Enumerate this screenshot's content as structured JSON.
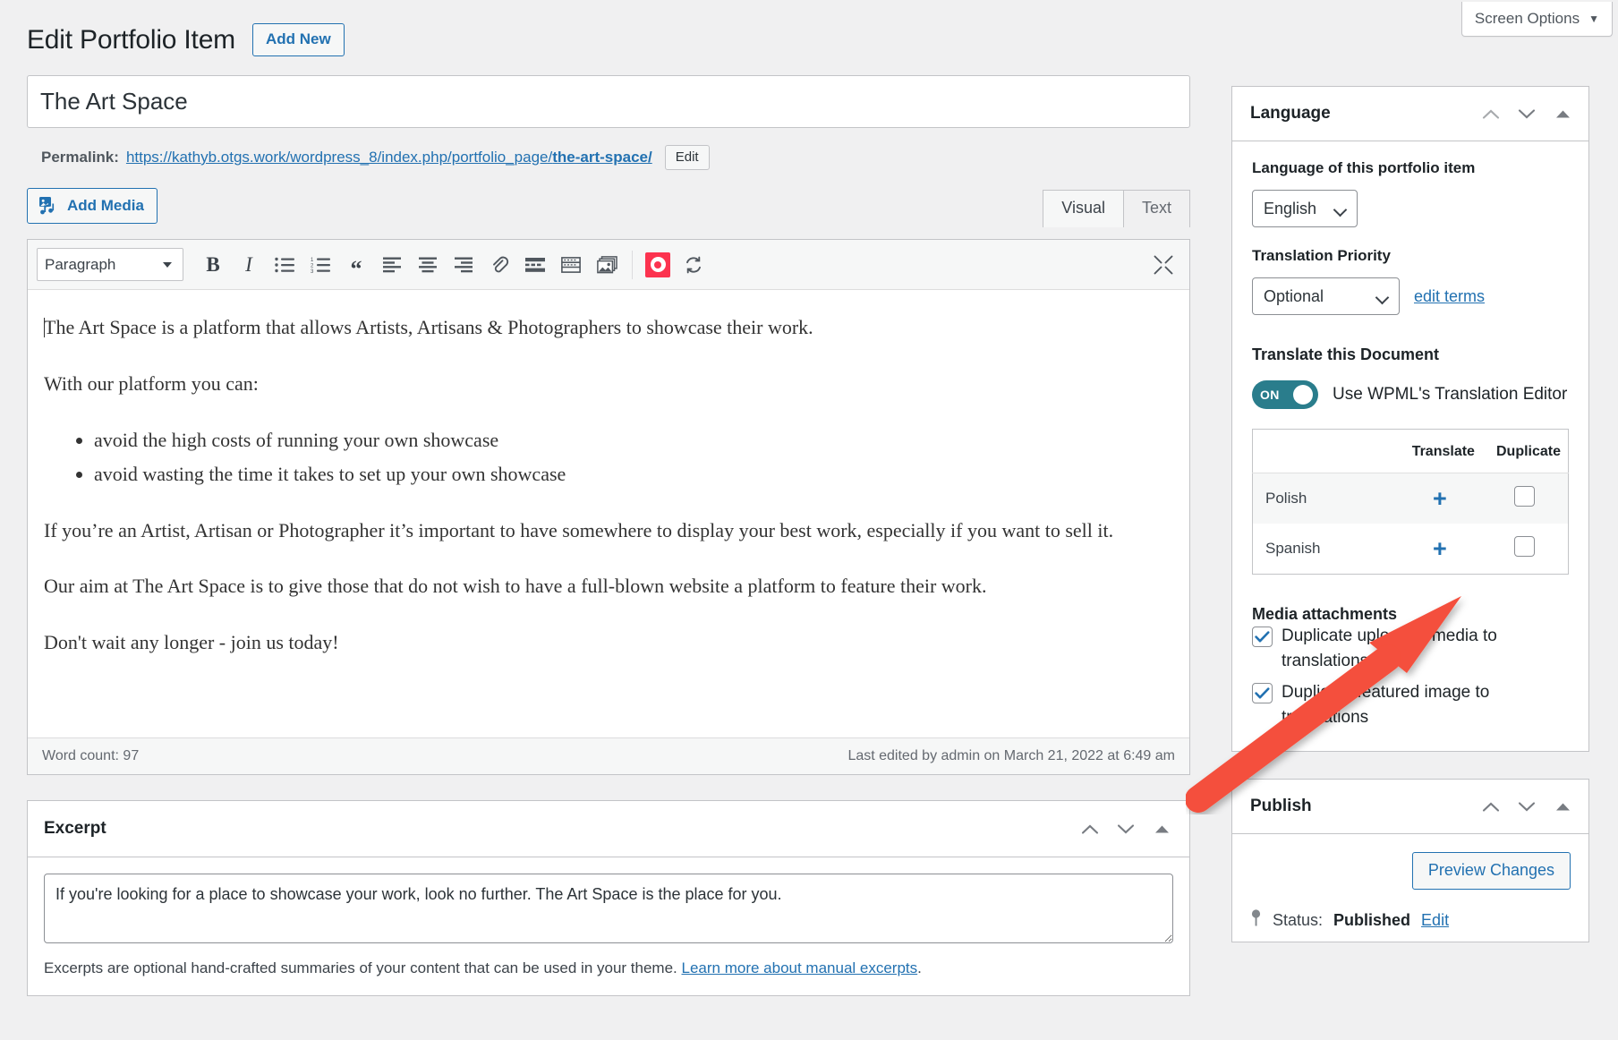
{
  "screen_options": {
    "label": "Screen Options",
    "caret": "▼"
  },
  "header": {
    "title": "Edit Portfolio Item",
    "add_new_label": "Add New"
  },
  "post": {
    "title_value": "The Art Space",
    "permalink_label": "Permalink:",
    "permalink_base": "https://kathyb.otgs.work/wordpress_8/index.php/portfolio_page/",
    "permalink_slug": "the-art-space/",
    "permalink_edit_label": "Edit"
  },
  "editor": {
    "add_media_label": "Add Media",
    "tabs": [
      {
        "label": "Visual",
        "active": true
      },
      {
        "label": "Text",
        "active": false
      }
    ],
    "toolbar": {
      "format_value": "Paragraph",
      "format_options": [
        "Paragraph"
      ],
      "buttons": [
        "bold-icon",
        "italic-icon",
        "bulleted-list-icon",
        "numbered-list-icon",
        "blockquote-icon",
        "align-left-icon",
        "align-center-icon",
        "align-right-icon",
        "link-icon",
        "read-more-icon",
        "toolbar-toggle-icon",
        "gallery-icon",
        "wpml-icon",
        "refresh-icon",
        "fullscreen-icon"
      ]
    },
    "content": {
      "p1": "The Art Space is a platform that allows Artists, Artisans & Photographers to showcase their work.",
      "p2": "With our platform you can:",
      "bullets": [
        "avoid the high costs of running your own showcase",
        "avoid wasting the time it takes to set up your own showcase"
      ],
      "p3": "If you’re an Artist, Artisan or Photographer it’s important to have somewhere to display your best work, especially if you want to sell it.",
      "p4": "Our aim at The Art Space is to give those that do not wish to have a full-blown website a platform to feature their work.",
      "p5": "Don't wait any longer - join us today!"
    },
    "status": {
      "word_count": "Word count: 97",
      "last_edited": "Last edited by admin on March 21, 2022 at 6:49 am"
    }
  },
  "excerpt": {
    "title": "Excerpt",
    "value": "If you're looking for a place to showcase your work, look no further. The Art Space is the place for you.",
    "help_text": "Excerpts are optional hand-crafted summaries of your content that can be used in your theme. ",
    "help_link": "Learn more about manual excerpts",
    "help_tail": "."
  },
  "language_panel": {
    "title": "Language",
    "language_field_label": "Language of this portfolio item",
    "language_value": "English",
    "language_options": [
      "English"
    ],
    "priority_label": "Translation Priority",
    "priority_value": "Optional",
    "priority_options": [
      "Optional"
    ],
    "edit_terms_label": "edit terms",
    "translate_doc_label": "Translate this Document",
    "toggle_state": "ON",
    "toggle_label": "Use WPML's Translation Editor",
    "table": {
      "headers": {
        "language": "",
        "translate": "Translate",
        "duplicate": "Duplicate"
      },
      "rows": [
        {
          "language": "Polish",
          "translate": "+",
          "duplicate_checked": false
        },
        {
          "language": "Spanish",
          "translate": "+",
          "duplicate_checked": false
        }
      ]
    },
    "media_attachments_label": "Media attachments",
    "media_options": [
      {
        "label": "Duplicate uploaded media to translations",
        "checked": true
      },
      {
        "label": "Duplicate featured image to translations",
        "checked": true
      }
    ]
  },
  "publish_panel": {
    "title": "Publish",
    "preview_label": "Preview Changes",
    "status_prefix": "Status:",
    "status_value": "Published",
    "status_edit_label": "Edit"
  },
  "colors": {
    "accent_blue": "#2271b1",
    "toggle_teal": "#2a7d8c",
    "wpml_pink": "#fc334f",
    "arrow_red": "#f4503c"
  }
}
